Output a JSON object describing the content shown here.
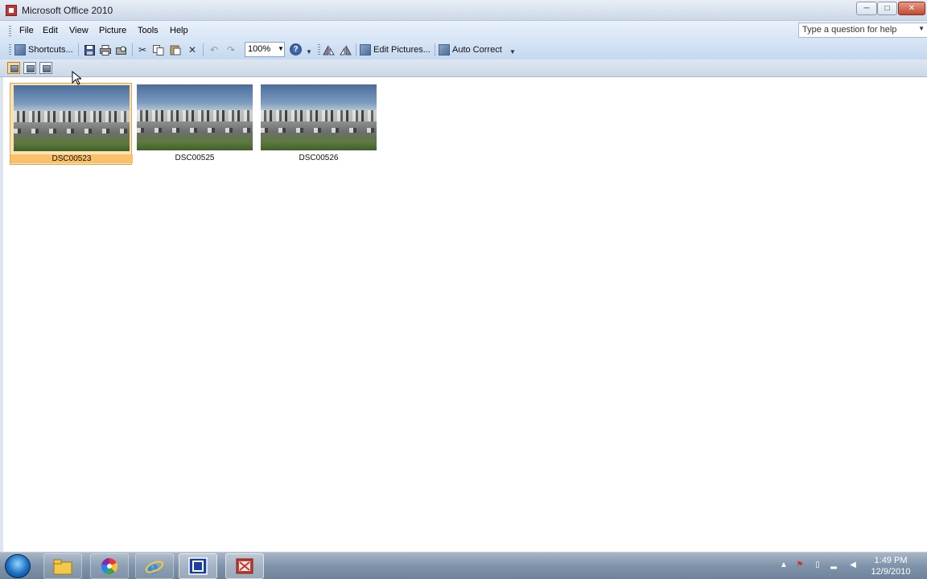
{
  "window": {
    "title": "Microsoft Office 2010",
    "controls": {
      "minimize": "─",
      "maximize": "□",
      "close": "✕"
    }
  },
  "menu": {
    "items": [
      "File",
      "Edit",
      "View",
      "Picture",
      "Tools",
      "Help"
    ]
  },
  "help_box": {
    "placeholder": "Type a question for help"
  },
  "toolbar": {
    "shortcuts_label": "Shortcuts...",
    "zoom_value": "100%",
    "help_glyph": "?",
    "edit_pictures_label": "Edit Pictures...",
    "auto_correct_label": "Auto Correct"
  },
  "thumbnails": [
    {
      "caption": "DSC00523",
      "selected": true
    },
    {
      "caption": "DSC00525",
      "selected": false
    },
    {
      "caption": "DSC00526",
      "selected": false
    }
  ],
  "taskbar": {
    "apps": [
      "windows-explorer",
      "picasa",
      "internet-explorer",
      "picture-manager",
      "office-app"
    ],
    "clock_time": "1:49 PM",
    "clock_date": "12/9/2010"
  },
  "colors": {
    "selection_fill": "#fbc16a",
    "menubar_bg": "#d6e4f5",
    "taskbar_bg": "#7f93aa"
  }
}
